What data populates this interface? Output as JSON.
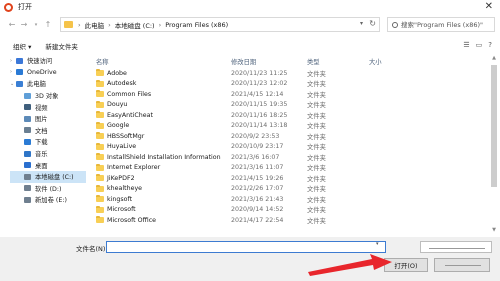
{
  "window": {
    "title": "打开"
  },
  "address": {
    "crumbs": [
      "此电脑",
      "本地磁盘 (C:)",
      "Program Files (x86)"
    ],
    "search_placeholder": "搜索\"Program Files (x86)\""
  },
  "toolbar": {
    "organize_label": "组织 ▾",
    "new_folder_label": "新建文件夹"
  },
  "sidebar": {
    "items": [
      {
        "label": "快速访问",
        "icon": "star-icon",
        "color": "#3b78d8"
      },
      {
        "label": "OneDrive",
        "icon": "cloud-icon",
        "color": "#2a7ad5"
      },
      {
        "label": "此电脑",
        "icon": "computer-icon",
        "color": "#3a7fd4"
      },
      {
        "label": "3D 对象",
        "icon": "cube-icon",
        "color": "#5f9fd8"
      },
      {
        "label": "视频",
        "icon": "video-icon",
        "color": "#3f5f7d"
      },
      {
        "label": "图片",
        "icon": "picture-icon",
        "color": "#5c8ab8"
      },
      {
        "label": "文档",
        "icon": "document-icon",
        "color": "#6a7f92"
      },
      {
        "label": "下载",
        "icon": "download-icon",
        "color": "#2b7bd4"
      },
      {
        "label": "音乐",
        "icon": "music-icon",
        "color": "#2f75c7"
      },
      {
        "label": "桌面",
        "icon": "desktop-icon",
        "color": "#2a6fcf"
      },
      {
        "label": "本地磁盘 (C:)",
        "icon": "drive-icon",
        "color": "#6f7f8f"
      },
      {
        "label": "软件 (D:)",
        "icon": "drive-icon",
        "color": "#6f7f8f"
      },
      {
        "label": "新加卷 (E:)",
        "icon": "drive-icon",
        "color": "#6f7f8f"
      }
    ]
  },
  "columns": {
    "name": "名称",
    "date": "修改日期",
    "type": "类型",
    "size": "大小"
  },
  "files": [
    {
      "name": "Adobe",
      "date": "2020/11/23 11:25",
      "type": "文件夹"
    },
    {
      "name": "Autodesk",
      "date": "2020/11/23 12:02",
      "type": "文件夹"
    },
    {
      "name": "Common Files",
      "date": "2021/4/15 12:14",
      "type": "文件夹"
    },
    {
      "name": "Douyu",
      "date": "2020/11/15 19:35",
      "type": "文件夹"
    },
    {
      "name": "EasyAntiCheat",
      "date": "2020/11/16 18:25",
      "type": "文件夹"
    },
    {
      "name": "Google",
      "date": "2020/11/14 13:18",
      "type": "文件夹"
    },
    {
      "name": "HBSSoftMgr",
      "date": "2020/9/2 23:53",
      "type": "文件夹"
    },
    {
      "name": "HuyaLive",
      "date": "2020/10/9 23:17",
      "type": "文件夹"
    },
    {
      "name": "InstallShield Installation Information",
      "date": "2021/3/6 16:07",
      "type": "文件夹"
    },
    {
      "name": "Internet Explorer",
      "date": "2021/3/16 11:07",
      "type": "文件夹"
    },
    {
      "name": "JiKePDF2",
      "date": "2021/4/15 19:26",
      "type": "文件夹"
    },
    {
      "name": "khealtheye",
      "date": "2021/2/26 17:07",
      "type": "文件夹"
    },
    {
      "name": "kingsoft",
      "date": "2021/3/16 21:43",
      "type": "文件夹"
    },
    {
      "name": "Microsoft",
      "date": "2020/9/14 14:52",
      "type": "文件夹"
    },
    {
      "name": "Microsoft Office",
      "date": "2021/4/17 22:54",
      "type": "文件夹"
    }
  ],
  "bottom": {
    "filename_label": "文件名(N):",
    "filename_value": "",
    "open_label": "打开(O)"
  },
  "colors": {
    "selection": "#cce4f7",
    "folder": "#f8cf55",
    "arrow": "#e8262c"
  }
}
